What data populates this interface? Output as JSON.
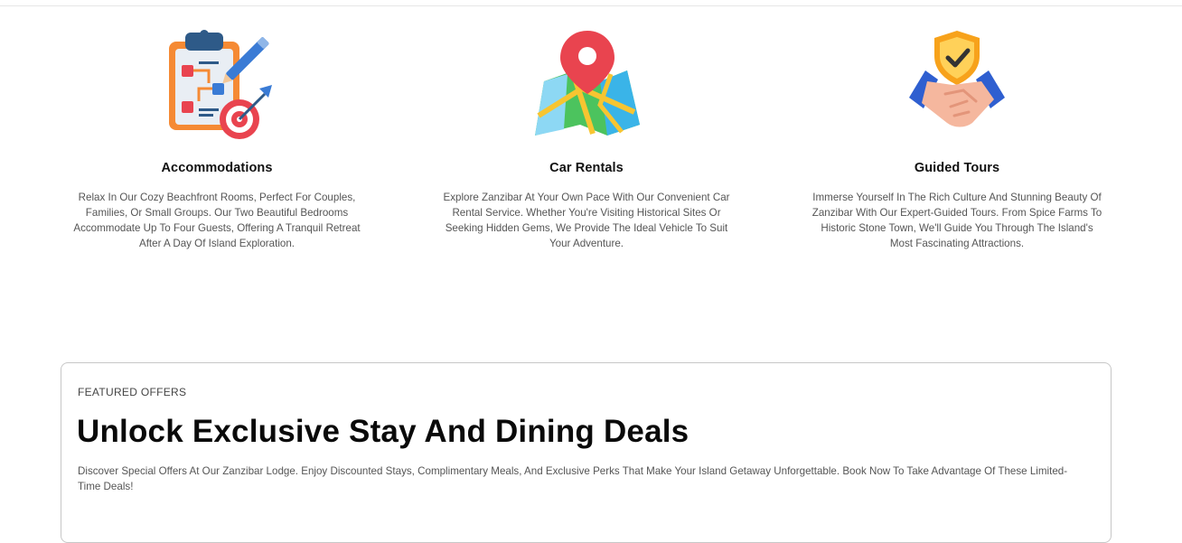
{
  "services": [
    {
      "icon": "planning-clipboard-target-icon",
      "title": "Accommodations",
      "description": "Relax In Our Cozy Beachfront Rooms, Perfect For Couples, Families, Or Small Groups. Our Two Beautiful Bedrooms Accommodate Up To Four Guests, Offering A Tranquil Retreat After A Day Of Island Exploration."
    },
    {
      "icon": "map-pin-icon",
      "title": "Car Rentals",
      "description": "Explore Zanzibar At Your Own Pace With Our Convenient Car Rental Service. Whether You're Visiting Historical Sites Or Seeking Hidden Gems, We Provide The Ideal Vehicle To Suit Your Adventure."
    },
    {
      "icon": "handshake-shield-icon",
      "title": "Guided Tours",
      "description": "Immerse Yourself In The Rich Culture And Stunning Beauty Of Zanzibar With Our Expert-Guided Tours. From Spice Farms To Historic Stone Town, We'll Guide You Through The Island's Most Fascinating Attractions."
    }
  ],
  "offers": {
    "eyebrow": "FEATURED OFFERS",
    "heading": "Unlock Exclusive Stay And Dining Deals",
    "text": "Discover Special Offers At Our Zanzibar Lodge. Enjoy Discounted Stays, Complimentary Meals, And Exclusive Perks That Make Your Island Getaway Unforgettable. Book Now To Take Advantage Of These Limited-Time Deals!"
  }
}
